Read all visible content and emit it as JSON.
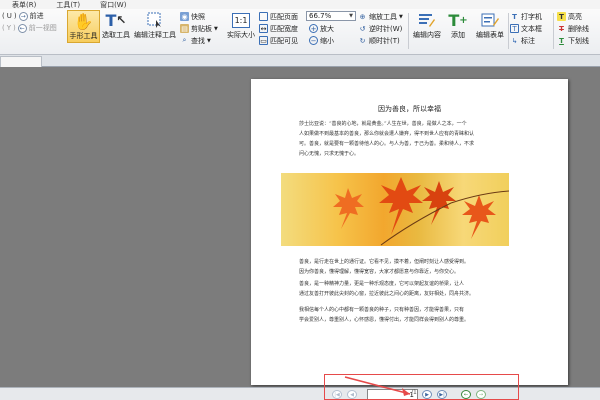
{
  "menubar": {
    "items": [
      "表单(R)",
      "工具(T)",
      "窗口(W)"
    ]
  },
  "nav": {
    "forward_label": "前进",
    "forward_key": "U",
    "back_label": "前一视图",
    "back_key": "Y"
  },
  "toolbar": {
    "hand_tool": "手形工具",
    "select_tool": "选取工具",
    "annotate_tool": "编辑注释工具",
    "snapshot": "快照",
    "clipboard": "剪贴板",
    "find": "查找",
    "actual_size": "实际大小",
    "actual_size_icon": "1:1",
    "fit_page": "匹配页面",
    "fit_width": "匹配宽度",
    "fit_visible": "匹配可见",
    "zoom_value": "66.7%",
    "zoom_tool": "缩放工具",
    "zoom_in": "放大",
    "zoom_out": "缩小",
    "rotate_ccw": "逆时针(W)",
    "rotate_cw": "顺时针(T)",
    "edit_content": "编辑内容",
    "add": "添加",
    "edit_form": "编辑表单",
    "typewriter": "打字机",
    "textbox": "文本框",
    "note": "标注",
    "highlight": "高亮",
    "strikeout": "删除线",
    "underline": "下划线"
  },
  "document": {
    "title": "因为善良，所以幸福",
    "paragraphs": [
      [
        "莎士比亚说：“善良的心地，就是黄金。”人生在世，善良，是做人之本，一个",
        "人如果做不到最基本的善良，那么你就会遭人嫌弃，得不到世人应有的青睐和认",
        "可。善良，就是要有一颗善待他人的心。与人为善，于己为善。柔和待人，不求",
        "问心无愧，只求无愧于心。"
      ],
      [
        "善良，是行走在世上的通行证。它看不见，摸不着，但阐时刻让人感受得到。",
        "因为你善良，懂得理解，懂得宽容，大家才都愿意与你靠近，与你交心。"
      ],
      [
        "善良，是一种精神力量，更是一种乐观态度，它可以架起友谊的桥梁，让人",
        "通过友善打开彼此尖封的心窗，拉近彼此之间心的距离，友好相处，同舟共济。"
      ],
      [
        "我相信每个人的心中都有一颗善良的种子，只有种善因，才能得善果，只有",
        "学会爱别人，尊重别人，心怀感恩，懂得付出，才能同样会得到别人的尊重。"
      ]
    ]
  },
  "pager": {
    "current_page": "1",
    "total_pages": "/1"
  },
  "colors": {
    "highlight_box": "#e64a4a",
    "active_tool": "#f7cd5d"
  }
}
